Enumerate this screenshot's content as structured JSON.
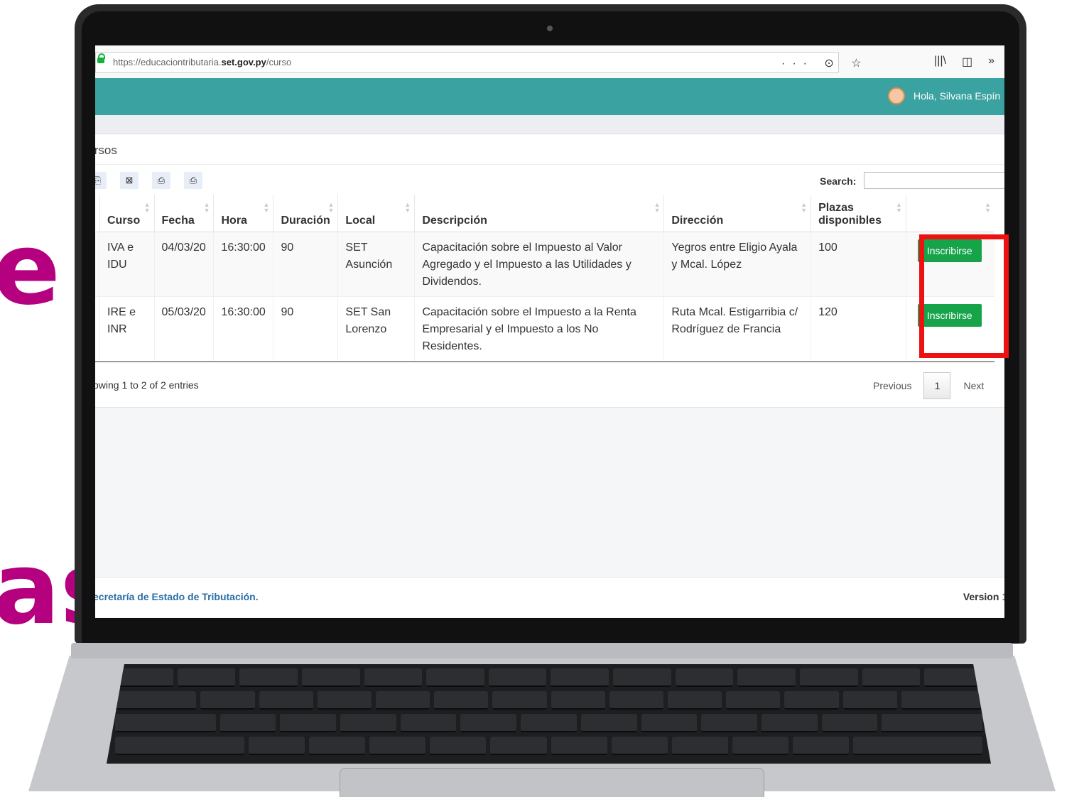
{
  "side_text": [
    "e",
    "as"
  ],
  "browser": {
    "url_prefix": "https://educaciontributaria.",
    "url_domain": "set.gov.py",
    "url_path": "/curso",
    "url_actions": "··· ⊙ ☆",
    "tool_icons": [
      "|||\\",
      "◫",
      "»"
    ]
  },
  "header": {
    "greeting": "Hola, Silvana Espín"
  },
  "panel": {
    "title": "ırsos"
  },
  "export_icons": [
    "⎘",
    "⊠",
    "⎙",
    "⎙"
  ],
  "search": {
    "label": "Search:",
    "value": ""
  },
  "table": {
    "headers": [
      "",
      "Curso",
      "Fecha",
      "Hora",
      "Duración",
      "Local",
      "Descripción",
      "Dirección",
      "Plazas disponibles",
      ""
    ],
    "rows": [
      {
        "curso": "IVA e IDU",
        "fecha": "04/03/20",
        "hora": "16:30:00",
        "duracion": "90",
        "local": "SET Asunción",
        "descripcion": "Capacitación sobre el Impuesto al Valor Agregado y el Impuesto a las Utilidades y Dividendos.",
        "direccion": "Yegros entre Eligio Ayala y Mcal. López",
        "plazas": "100",
        "action": "Inscribirse"
      },
      {
        "curso": "IRE e INR",
        "fecha": "05/03/20",
        "hora": "16:30:00",
        "duracion": "90",
        "local": "SET San Lorenzo",
        "descripcion": "Capacitación sobre el Impuesto a la Renta Empresarial y el Impuesto a los No Residentes.",
        "direccion": "Ruta Mcal. Estigarribia c/ Rodríguez de Francia",
        "plazas": "120",
        "action": "Inscribirse"
      }
    ]
  },
  "pagination": {
    "info": "owing 1 to 2 of 2 entries",
    "previous": "Previous",
    "current_page": "1",
    "next": "Next"
  },
  "footer": {
    "left": "ecretaría de Estado de Tributación.",
    "right_bold": "Version",
    "right_rest": " 1."
  },
  "colors": {
    "accent": "#3aa2a0",
    "button": "#16a34a",
    "highlight": "#ee1111",
    "side_text": "#b5007f"
  }
}
